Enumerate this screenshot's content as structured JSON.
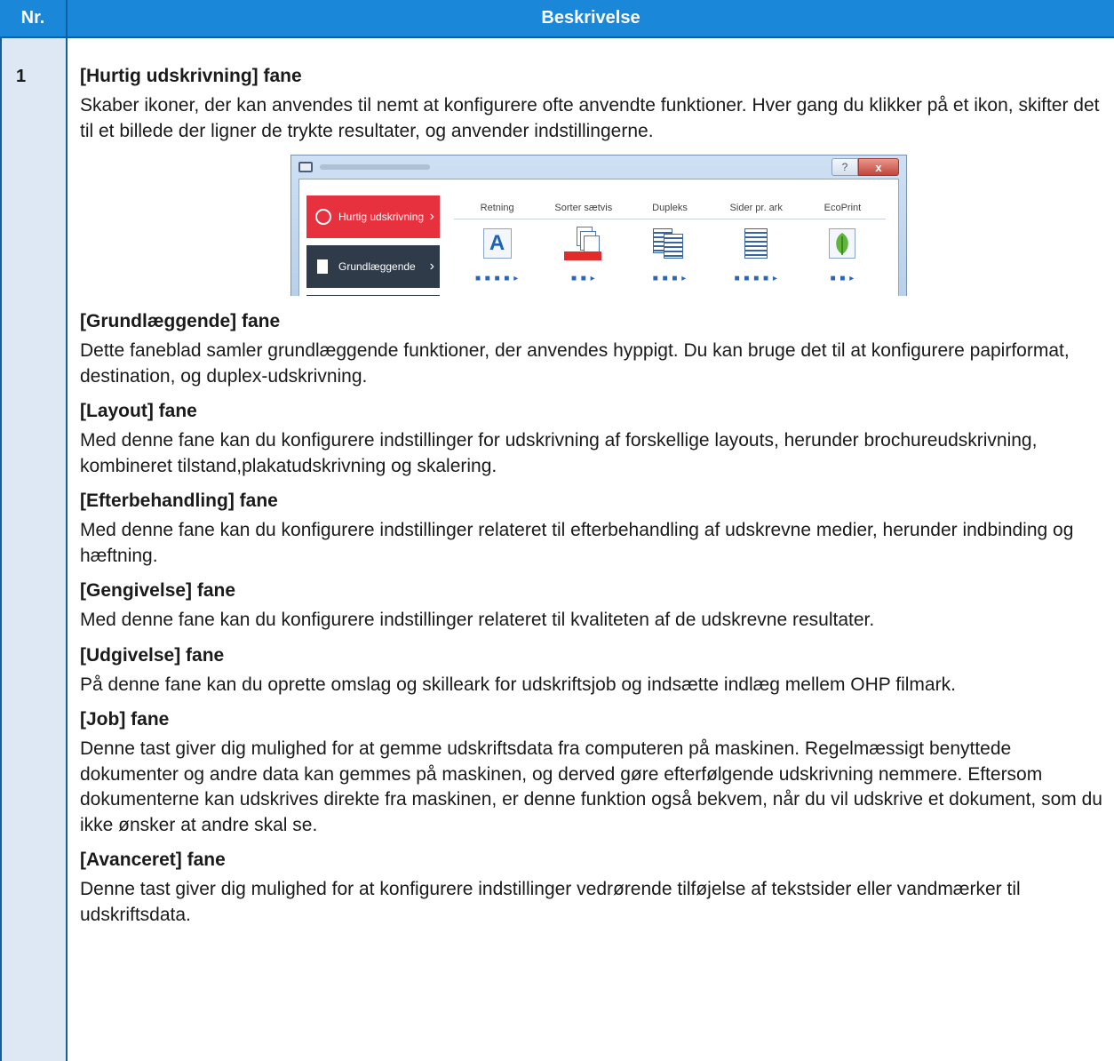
{
  "table": {
    "header_nr": "Nr.",
    "header_desc": "Beskrivelse",
    "row_number": "1"
  },
  "sections": [
    {
      "title": "[Hurtig udskrivning] fane",
      "body": "Skaber ikoner, der kan anvendes til nemt at konfigurere ofte anvendte funktioner. Hver gang du klikker på et ikon, skifter det til et billede der ligner de trykte resultater, og anvender indstillingerne."
    },
    {
      "title": "[Grundlæggende] fane",
      "body": "Dette faneblad samler grundlæggende funktioner, der anvendes hyppigt. Du kan bruge det til at konfigurere papirformat, destination, og duplex-udskrivning."
    },
    {
      "title": "[Layout] fane",
      "body": "Med denne fane kan du konfigurere indstillinger for udskrivning af forskellige layouts, herunder brochureudskrivning, kombineret tilstand,plakatudskrivning og skalering."
    },
    {
      "title": "[Efterbehandling] fane",
      "body": "Med denne fane kan du konfigurere indstillinger relateret til efterbehandling af udskrevne medier, herunder indbinding og hæftning."
    },
    {
      "title": "[Gengivelse] fane",
      "body": "Med denne fane kan du konfigurere indstillinger relateret til kvaliteten af de udskrevne resultater."
    },
    {
      "title": "[Udgivelse] fane",
      "body": "På denne fane kan du oprette omslag og skilleark for udskriftsjob og indsætte indlæg mellem OHP filmark."
    },
    {
      "title": "[Job] fane",
      "body": "Denne tast giver dig mulighed for at gemme udskriftsdata fra computeren på maskinen. Regelmæssigt benyttede dokumenter og andre data kan gemmes på maskinen, og derved gøre efterfølgende udskrivning nemmere. Eftersom dokumenterne kan udskrives direkte fra maskinen, er denne funktion også bekvem, når du vil udskrive et dokument, som du ikke ønsker at andre skal se."
    },
    {
      "title": "[Avanceret] fane",
      "body": "Denne tast giver dig mulighed for at konfigurere indstillinger vedrørende tilføjelse af tekstsider eller vandmærker til udskriftsdata."
    }
  ],
  "screenshot": {
    "tabs": [
      "Hurtig udskrivning",
      "Grundlæggende"
    ],
    "options": [
      "Retning",
      "Sorter sætvis",
      "Dupleks",
      "Sider pr. ark",
      "EcoPrint"
    ],
    "orientation_letter": "A",
    "help_glyph": "?",
    "close_glyph": "x",
    "accent_color": "#e8313f",
    "header_color": "#1a87d9"
  }
}
